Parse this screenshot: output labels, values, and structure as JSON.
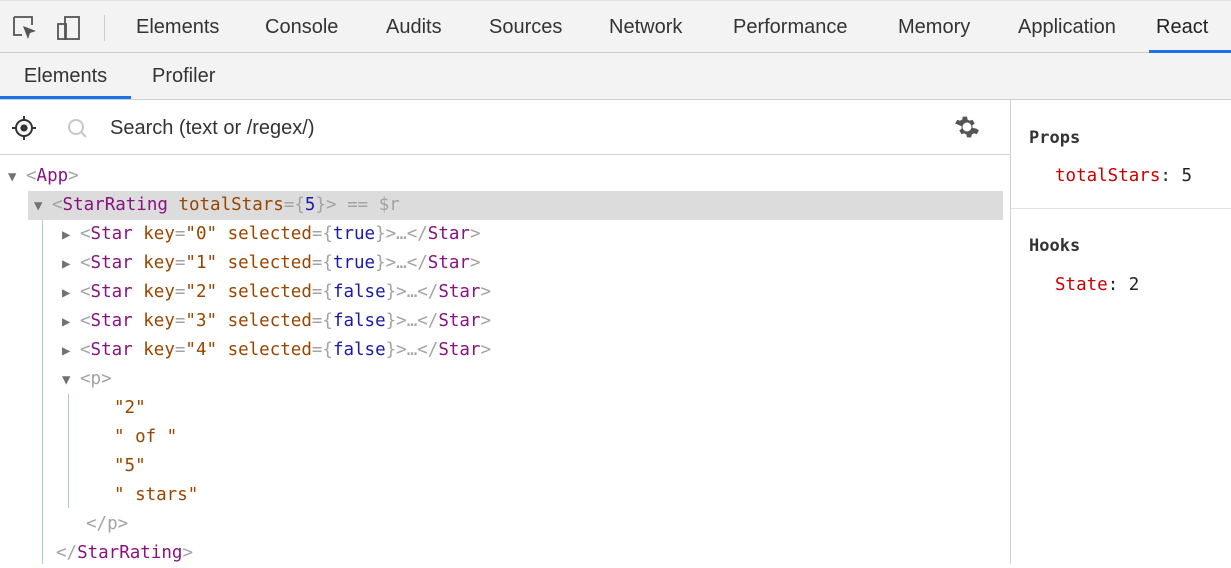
{
  "devtools": {
    "tabs": [
      {
        "label": "Elements"
      },
      {
        "label": "Console"
      },
      {
        "label": "Audits"
      },
      {
        "label": "Sources"
      },
      {
        "label": "Network"
      },
      {
        "label": "Performance"
      },
      {
        "label": "Memory"
      },
      {
        "label": "Application"
      },
      {
        "label": "React"
      }
    ],
    "active_tab": "React"
  },
  "react": {
    "subtabs": [
      {
        "label": "Elements"
      },
      {
        "label": "Profiler"
      }
    ],
    "active_subtab": "Elements",
    "search": {
      "placeholder": "Search (text or /regex/)",
      "value": ""
    }
  },
  "tree": {
    "app": {
      "open": "<",
      "name": "App",
      "close": ">"
    },
    "star_rating": {
      "open": "<",
      "name": "StarRating",
      "attr": "totalStars",
      "eq": "=",
      "brace_open": "{",
      "value": "5",
      "brace_close": "}",
      "close": ">",
      "suffix": " == $r"
    },
    "stars": [
      {
        "tag": "Star",
        "key_attr": "key",
        "key_value": "\"0\"",
        "sel_attr": "selected",
        "sel_value": "true",
        "tail": ">…</",
        "end": "Star",
        "close": ">"
      },
      {
        "tag": "Star",
        "key_attr": "key",
        "key_value": "\"1\"",
        "sel_attr": "selected",
        "sel_value": "true",
        "tail": ">…</",
        "end": "Star",
        "close": ">"
      },
      {
        "tag": "Star",
        "key_attr": "key",
        "key_value": "\"2\"",
        "sel_attr": "selected",
        "sel_value": "false",
        "tail": ">…</",
        "end": "Star",
        "close": ">"
      },
      {
        "tag": "Star",
        "key_attr": "key",
        "key_value": "\"3\"",
        "sel_attr": "selected",
        "sel_value": "false",
        "tail": ">…</",
        "end": "Star",
        "close": ">"
      },
      {
        "tag": "Star",
        "key_attr": "key",
        "key_value": "\"4\"",
        "sel_attr": "selected",
        "sel_value": "false",
        "tail": ">…</",
        "end": "Star",
        "close": ">"
      }
    ],
    "p_open": {
      "open": "<",
      "name": "p",
      "close": ">"
    },
    "p_text": [
      "\"2\"",
      "\" of \"",
      "\"5\"",
      "\" stars\""
    ],
    "p_close": {
      "open": "</",
      "name": "p",
      "close": ">"
    },
    "star_rating_close": {
      "open": "</",
      "name": "StarRating",
      "close": ">"
    }
  },
  "side_panel": {
    "props_title": "Props",
    "props": [
      {
        "key": "totalStars",
        "colon": ":",
        "value": "5"
      }
    ],
    "hooks_title": "Hooks",
    "hooks": [
      {
        "key": "State",
        "colon": ":",
        "value": "2"
      }
    ]
  },
  "colors": {
    "accent": "#1a73e8",
    "tag": "#881280",
    "attr": "#994500",
    "value": "#1a1aa6",
    "prop_key": "#c80000"
  }
}
